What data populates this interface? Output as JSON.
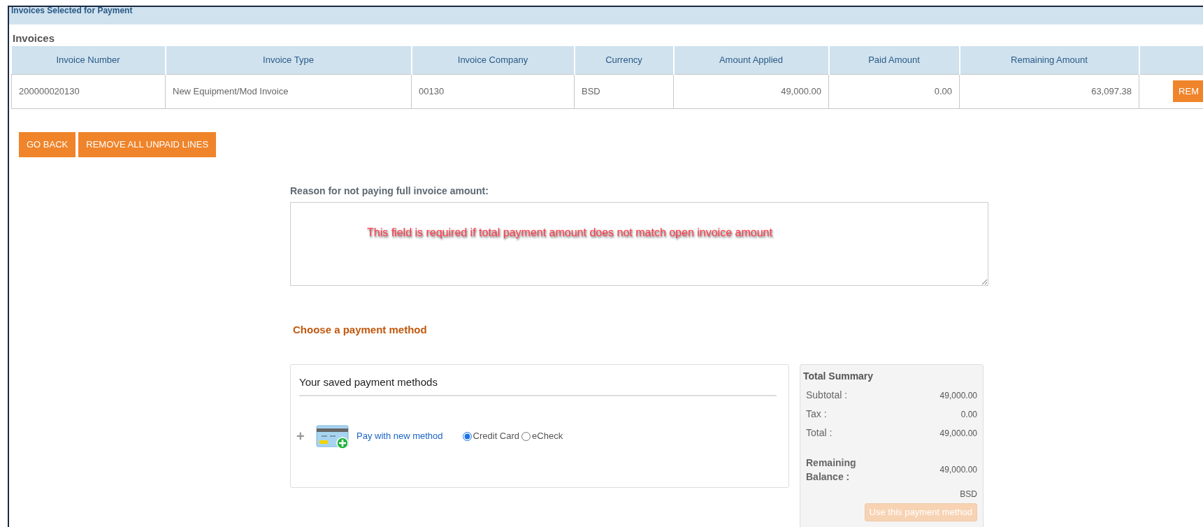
{
  "panel_header": "Invoices Selected for Payment",
  "section_title": "Invoices",
  "table": {
    "columns": [
      "Invoice Number",
      "Invoice Type",
      "Invoice Company",
      "Currency",
      "Amount Applied",
      "Paid Amount",
      "Remaining Amount"
    ],
    "rows": [
      {
        "cells": [
          "200000020130",
          "New Equipment/Mod Invoice",
          "00130",
          "BSD",
          "49,000.00",
          "0.00",
          "63,097.38"
        ],
        "action": "REM"
      }
    ]
  },
  "buttons": [
    "GO BACK",
    "REMOVE ALL UNPAID LINES"
  ],
  "reason": {
    "label": "Reason for not paying full invoice amount:",
    "error": "This field is required if total payment amount does not match open invoice amount"
  },
  "payment_heading": "Choose a payment method",
  "saved_methods": {
    "title": "Your saved payment methods",
    "expand": "+",
    "new_method_link": "Pay with new method",
    "options": [
      {
        "label": "Credit Card",
        "selected": true
      },
      {
        "label": "eCheck",
        "selected": false
      }
    ]
  },
  "summary": {
    "title": "Total Summary",
    "rows": [
      {
        "label": "Subtotal :",
        "value": "49,000.00",
        "bold": false
      },
      {
        "label": "Tax :",
        "value": "0.00",
        "bold": false
      },
      {
        "label": "Total :",
        "value": "49,000.00",
        "bold": false
      },
      {
        "label": "Remaining Balance :",
        "value": "49,000.00",
        "bold": true
      }
    ],
    "currency": "BSD",
    "button": {
      "label": "Use this payment method",
      "disabled": true
    }
  }
}
